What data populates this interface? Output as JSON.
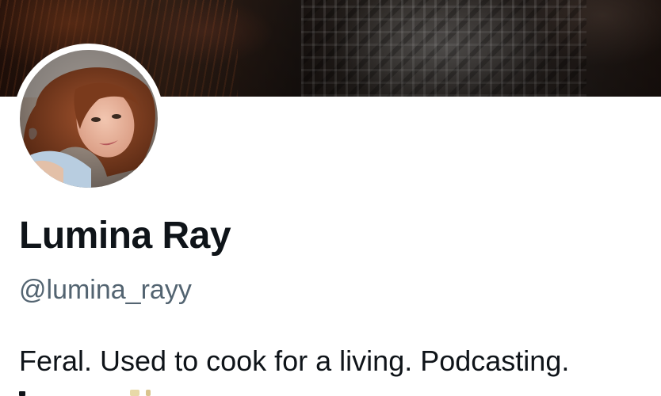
{
  "profile": {
    "display_name": "Lumina Ray",
    "handle": "@lumina_rayy",
    "bio": "Feral. Used to cook for a living. Podcasting."
  },
  "colors": {
    "name_text": "#0f1419",
    "handle_text": "#536471",
    "background": "#ffffff"
  },
  "icons": {
    "avatar": "profile-photo",
    "banner": "header-photo"
  }
}
